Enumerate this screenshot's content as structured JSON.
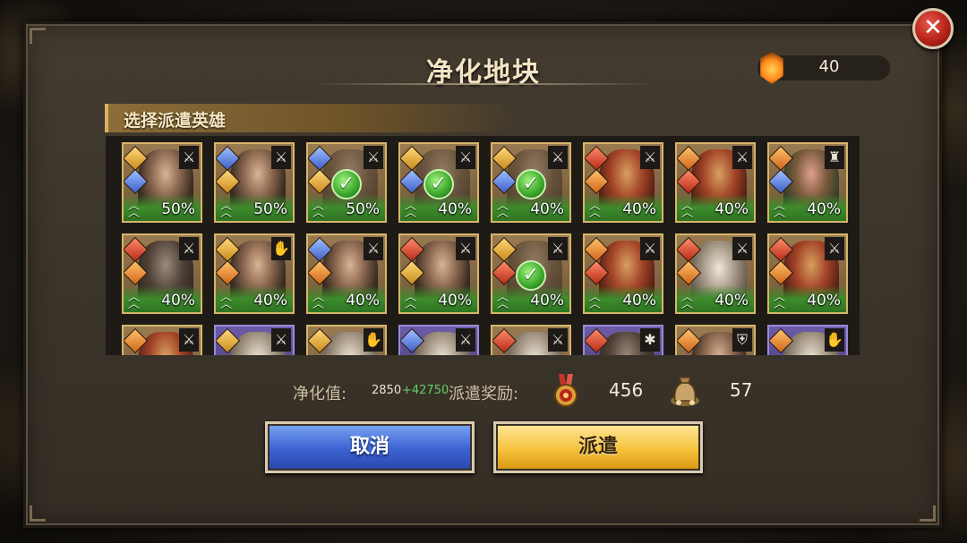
{
  "dialog": {
    "title": "净化地块",
    "resource_value": "40",
    "section_label": "选择派遣英雄",
    "close_label": "✕"
  },
  "heroes": [
    {
      "percent": "50%",
      "selected": false,
      "role": "sword-icon",
      "badges": [
        "gold",
        "blue"
      ],
      "look": "portrait",
      "frame": "gold"
    },
    {
      "percent": "50%",
      "selected": false,
      "role": "sword-icon",
      "badges": [
        "blue",
        "gold"
      ],
      "look": "portrait",
      "frame": "gold"
    },
    {
      "percent": "50%",
      "selected": true,
      "role": "sword-icon",
      "badges": [
        "blue",
        "gold"
      ],
      "look": "dark",
      "frame": "gold"
    },
    {
      "percent": "40%",
      "selected": true,
      "role": "sword-icon",
      "badges": [
        "gold",
        "blue"
      ],
      "look": "dark",
      "frame": "gold"
    },
    {
      "percent": "40%",
      "selected": true,
      "role": "sword-icon",
      "badges": [
        "gold",
        "blue"
      ],
      "look": "dark",
      "frame": "gold"
    },
    {
      "percent": "40%",
      "selected": false,
      "role": "sword-icon",
      "badges": [
        "red",
        "orange"
      ],
      "look": "red",
      "frame": "gold"
    },
    {
      "percent": "40%",
      "selected": false,
      "role": "sword-icon",
      "badges": [
        "orange",
        "red"
      ],
      "look": "red",
      "frame": "gold"
    },
    {
      "percent": "40%",
      "selected": false,
      "role": "rook-icon",
      "badges": [
        "orange",
        "blue"
      ],
      "look": "green",
      "frame": "gold"
    },
    {
      "percent": "40%",
      "selected": false,
      "role": "sword-icon",
      "badges": [
        "red",
        "orange"
      ],
      "look": "dark",
      "frame": "gold"
    },
    {
      "percent": "40%",
      "selected": false,
      "role": "hands-icon",
      "badges": [
        "gold",
        "orange"
      ],
      "look": "portrait",
      "frame": "gold"
    },
    {
      "percent": "40%",
      "selected": false,
      "role": "sword-icon",
      "badges": [
        "blue",
        "orange"
      ],
      "look": "portrait",
      "frame": "gold"
    },
    {
      "percent": "40%",
      "selected": false,
      "role": "sword-icon",
      "badges": [
        "red",
        "gold"
      ],
      "look": "portrait",
      "frame": "gold"
    },
    {
      "percent": "40%",
      "selected": true,
      "role": "sword-icon",
      "badges": [
        "gold",
        "red"
      ],
      "look": "dark",
      "frame": "gold"
    },
    {
      "percent": "40%",
      "selected": false,
      "role": "sword-icon",
      "badges": [
        "orange",
        "red"
      ],
      "look": "red",
      "frame": "gold"
    },
    {
      "percent": "40%",
      "selected": false,
      "role": "sword-icon",
      "badges": [
        "red",
        "orange"
      ],
      "look": "white",
      "frame": "gold"
    },
    {
      "percent": "40%",
      "selected": false,
      "role": "sword-icon",
      "badges": [
        "red",
        "orange"
      ],
      "look": "red",
      "frame": "gold"
    },
    {
      "percent": "",
      "selected": false,
      "role": "sword-icon",
      "badges": [
        "orange"
      ],
      "look": "red",
      "frame": "gold"
    },
    {
      "percent": "",
      "selected": false,
      "role": "sword-icon",
      "badges": [
        "gold"
      ],
      "look": "white",
      "frame": "purple"
    },
    {
      "percent": "",
      "selected": false,
      "role": "hands-icon",
      "badges": [
        "gold"
      ],
      "look": "white",
      "frame": "gold"
    },
    {
      "percent": "",
      "selected": false,
      "role": "sword-icon",
      "badges": [
        "blue"
      ],
      "look": "white",
      "frame": "purple"
    },
    {
      "percent": "",
      "selected": false,
      "role": "sword-icon",
      "badges": [
        "red"
      ],
      "look": "white",
      "frame": "gold"
    },
    {
      "percent": "",
      "selected": false,
      "role": "staff-icon",
      "badges": [
        "red"
      ],
      "look": "dark",
      "frame": "purple"
    },
    {
      "percent": "",
      "selected": false,
      "role": "shield-icon",
      "badges": [
        "orange"
      ],
      "look": "portrait",
      "frame": "gold"
    },
    {
      "percent": "",
      "selected": false,
      "role": "hands-icon",
      "badges": [
        "orange"
      ],
      "look": "white",
      "frame": "purple"
    }
  ],
  "footer": {
    "purify_label": "净化值:",
    "purify_base": "2850",
    "purify_bonus": "+42750",
    "reward_label": "派遣奖励:",
    "medal_value": "456",
    "bag_value": "57"
  },
  "buttons": {
    "cancel": "取消",
    "dispatch": "派遣"
  },
  "colors": {
    "frame_gold": "#d7b56a",
    "frame_purple": "#9a8ad6",
    "bonus_green": "#5fd06a",
    "cancel_blue": "#3c62d2",
    "dispatch_gold": "#f5c23c"
  }
}
